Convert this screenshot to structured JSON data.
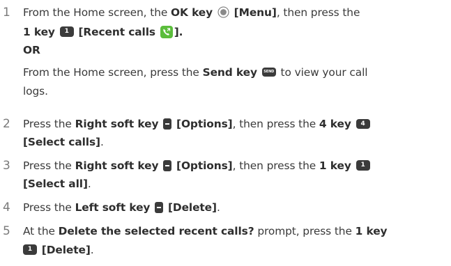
{
  "steps": [
    {
      "number": "1",
      "line1_pre": "From the Home screen, the ",
      "line1_b1": "OK key",
      "line1_b2": "[Menu]",
      "line1_post": ", then press the",
      "line2_b1": "1 key",
      "line2_b2": "[Recent calls",
      "line2_post": "].",
      "or_label": "OR",
      "alt_pre": "From the Home screen, press the ",
      "alt_b1": "Send key",
      "alt_post": " to view your call",
      "alt_cont": "logs."
    },
    {
      "number": "2",
      "line1_pre": "Press the ",
      "line1_b1": "Right soft key",
      "line1_b2": "[Options]",
      "line1_mid": ", then press the ",
      "line1_b3": "4 key",
      "line2_b1": "[Select calls]",
      "line2_post": "."
    },
    {
      "number": "3",
      "line1_pre": "Press the ",
      "line1_b1": "Right soft key",
      "line1_b2": "[Options]",
      "line1_mid": ", then press the ",
      "line1_b3": "1 key",
      "line2_b1": "[Select all]",
      "line2_post": "."
    },
    {
      "number": "4",
      "line1_pre": "Press the ",
      "line1_b1": "Left soft key",
      "line1_b2": "[Delete]",
      "line1_post": "."
    },
    {
      "number": "5",
      "line1_pre": "At the ",
      "line1_b1": "Delete the selected recent calls?",
      "line1_mid": " prompt, press the ",
      "line1_b2": "1 key",
      "line2_b1": "[Delete]",
      "line2_post": "."
    }
  ],
  "key_glyphs": {
    "one": "1",
    "four": "4",
    "send": "SEND"
  },
  "icons": {
    "ok_key": "ok-key-icon",
    "recent_calls": "phone-call-icon",
    "soft_key": "soft-key-icon"
  },
  "colors": {
    "text": "#3a3a3a",
    "key_fill": "#3b3b3b",
    "recent_calls_icon": "#5bbd3c"
  }
}
